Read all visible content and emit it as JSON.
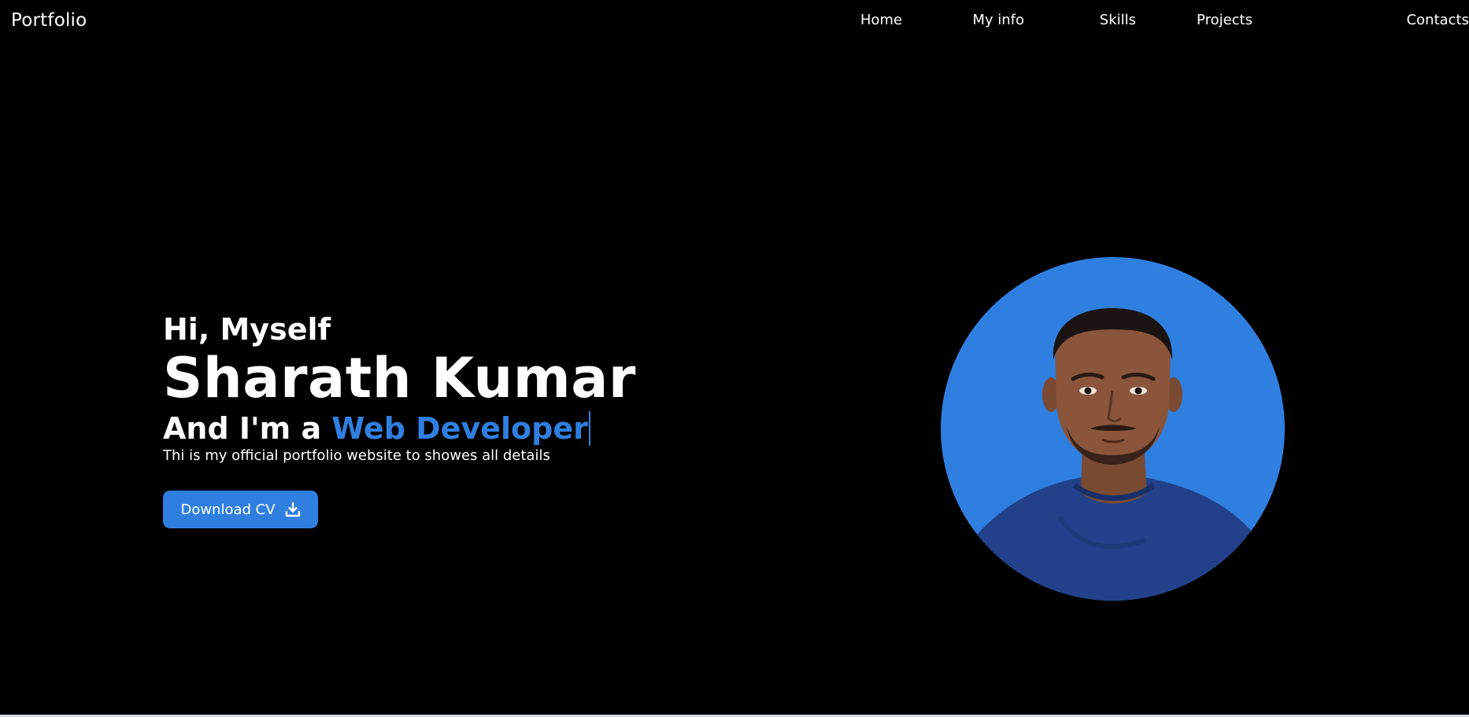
{
  "brand": {
    "label": "Portfolio"
  },
  "nav": {
    "items": [
      "Home",
      "My info",
      "Skills",
      "Projects",
      "Contacts"
    ]
  },
  "hero": {
    "greeting": "Hi, Myself",
    "name": "Sharath Kumar",
    "role_prefix": "And I'm a ",
    "role_highlight": "Web Developer",
    "description": "Thi is my official portfolio website to showes all details",
    "cv_button_label": "Download CV"
  },
  "icons": {
    "download": "download-icon"
  },
  "colors": {
    "background": "#000000",
    "accent": "#2f7fe0",
    "text": "#ffffff"
  }
}
